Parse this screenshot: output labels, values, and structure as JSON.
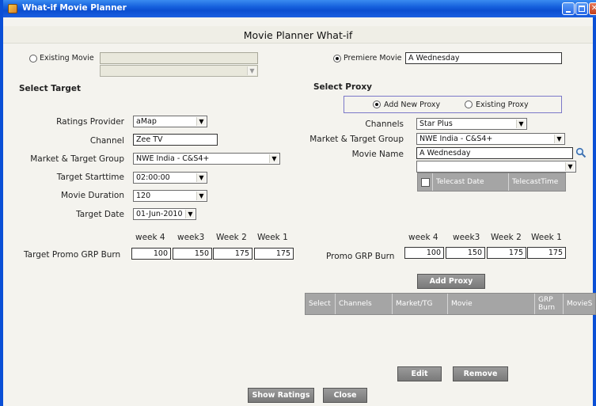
{
  "window": {
    "title": "What-if Movie Planner",
    "header": "Movie Planner What-if",
    "controls": {
      "minimize": "minimize-icon",
      "maximize": "maximize-icon",
      "close": "✕"
    }
  },
  "movie_source": {
    "existing_label": "Existing Movie",
    "existing_selected": false,
    "existing_value": "",
    "existing_dropdown_value": "",
    "premiere_label": "Premiere Movie",
    "premiere_selected": true,
    "premiere_value": "A Wednesday"
  },
  "target": {
    "section_title": "Select Target",
    "ratings_provider_label": "Ratings Provider",
    "ratings_provider_value": "aMap",
    "channel_label": "Channel",
    "channel_value": "Zee TV",
    "market_label": "Market & Target Group",
    "market_value": "NWE India - C&S4+",
    "starttime_label": "Target Starttime",
    "starttime_value": "02:00:00",
    "duration_label": "Movie Duration",
    "duration_value": "120",
    "date_label": "Target Date",
    "date_value": "01-Jun-2010",
    "weeks": [
      "week 4",
      "week3",
      "Week 2",
      "Week 1"
    ],
    "grp_label": "Target Promo GRP Burn",
    "grp_values": [
      "100",
      "150",
      "175",
      "175"
    ]
  },
  "proxy": {
    "section_title": "Select Proxy",
    "add_new_label": "Add New Proxy",
    "add_new_selected": true,
    "existing_label": "Existing Proxy",
    "existing_selected": false,
    "channels_label": "Channels",
    "channels_value": "Star Plus",
    "market_label": "Market & Target Group",
    "market_value": "NWE India - C&S4+",
    "movie_name_label": "Movie Name",
    "movie_name_value": "A Wednesday",
    "movie_dropdown_value": "",
    "telecast_columns": [
      "Telecast Date",
      "TelecastTime"
    ],
    "weeks": [
      "week 4",
      "week3",
      "Week 2",
      "Week 1"
    ],
    "grp_label": "Promo GRP Burn",
    "grp_values": [
      "100",
      "150",
      "175",
      "175"
    ],
    "add_button": "Add Proxy",
    "grid_columns": [
      "Select",
      "Channels",
      "Market/TG",
      "Movie",
      "GRP Burn",
      "MovieS"
    ],
    "edit_button": "Edit",
    "remove_button": "Remove"
  },
  "footer": {
    "show_ratings_button": "Show Ratings",
    "close_button": "Close"
  },
  "colors": {
    "titlebar": "#0b4ed0",
    "background": "#f4f3ee",
    "button": "#8a8a8a",
    "proxy_border": "#7b78c8"
  }
}
